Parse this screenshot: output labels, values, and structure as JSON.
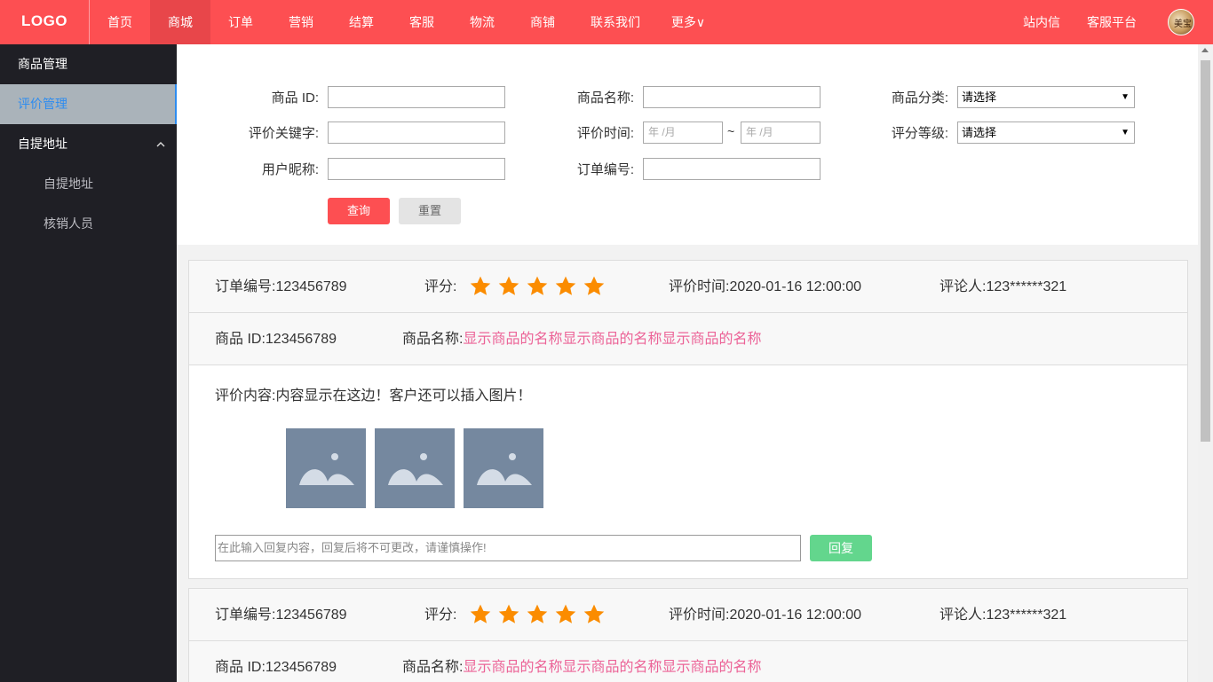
{
  "header": {
    "logo": "LOGO",
    "nav": [
      "首页",
      "商城",
      "订单",
      "营销",
      "结算",
      "客服",
      "物流",
      "商铺",
      "联系我们",
      "更多∨"
    ],
    "active_nav": 1,
    "right_links": [
      "站内信",
      "客服平台"
    ],
    "avatar_text": "美宝",
    "accent_color": "#fd4f52"
  },
  "sidebar": {
    "items": [
      {
        "label": "商品管理"
      },
      {
        "label": "评价管理"
      },
      {
        "label": "自提地址"
      },
      {
        "label": "自提地址"
      },
      {
        "label": "核销人员"
      }
    ],
    "active_color": "#2d8cf0"
  },
  "filter": {
    "product_id_label": "商品 ID:",
    "product_name_label": "商品名称:",
    "category_label": "商品分类:",
    "category_value": "请选择",
    "keyword_label": "评价关键字:",
    "time_label": "评价时间:",
    "date_placeholder_start": "年 /月",
    "date_placeholder_end": "年 /月",
    "tilde": "~",
    "grade_label": "评分等级:",
    "grade_value": "请选择",
    "nickname_label": "用户昵称:",
    "order_no_label": "订单编号:",
    "query_button": "查询",
    "reset_button": "重置"
  },
  "reviews": [
    {
      "order_label": "订单编号:",
      "order_no": "123456789",
      "score_label": "评分:",
      "rating": 5,
      "time_label": "评价时间:",
      "time": "2020-01-16 12:00:00",
      "reviewer_label": "评论人:",
      "reviewer": "123******321",
      "product_id_label": "商品 ID:",
      "product_id": "123456789",
      "product_name_label": "商品名称:",
      "product_name": "显示商品的名称显示商品的名称显示商品的名称",
      "content_label": "评价内容:",
      "content": "内容显示在这边！客户还可以插入图片！",
      "image_count": 3,
      "reply_placeholder": "在此输入回复内容，回复后将不可更改，请谨慎操作!",
      "reply_button": "回复"
    },
    {
      "order_label": "订单编号:",
      "order_no": "123456789",
      "score_label": "评分:",
      "rating": 5,
      "time_label": "评价时间:",
      "time": "2020-01-16 12:00:00",
      "reviewer_label": "评论人:",
      "reviewer": "123******321",
      "product_id_label": "商品 ID:",
      "product_id": "123456789",
      "product_name_label": "商品名称:",
      "product_name": "显示商品的名称显示商品的名称显示商品的名称"
    }
  ],
  "star_color": "#fb8c00",
  "link_color": "#ec6397"
}
